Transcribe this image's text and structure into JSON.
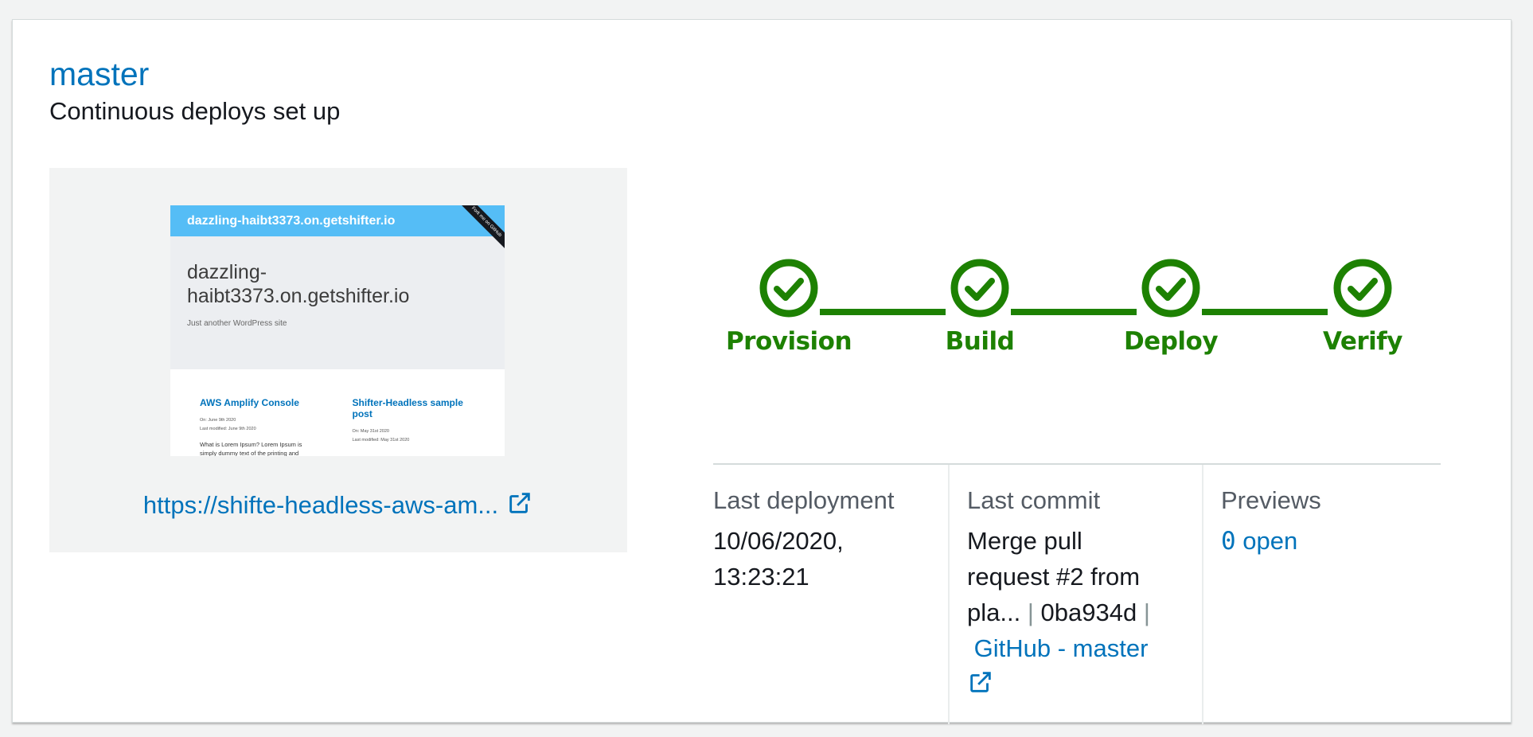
{
  "branch": {
    "name": "master",
    "status": "Continuous deploys set up"
  },
  "preview": {
    "site_bar_title": "dazzling-haibt3373.on.getshifter.io",
    "ribbon": "Fork me on GitHub",
    "hero_title": "dazzling-haibt3373.on.getshifter.io",
    "hero_tagline": "Just another WordPress site",
    "posts": [
      {
        "title": "AWS Amplify Console",
        "date": "On: June 9th 2020",
        "modified": "Last modified: June 9th 2020",
        "excerpt": "What is Lorem Ipsum? Lorem Ipsum is simply dummy text of the printing and typesetting"
      },
      {
        "title": "Shifter-Headless sample post",
        "date": "On: May 31st 2020",
        "modified": "Last modified: May 31st 2020",
        "excerpt": ""
      }
    ],
    "url": "https://shifte-headless-aws-am..."
  },
  "pipeline": {
    "color": "#1d8102",
    "steps": [
      {
        "label": "Provision",
        "status": "complete"
      },
      {
        "label": "Build",
        "status": "complete"
      },
      {
        "label": "Deploy",
        "status": "complete"
      },
      {
        "label": "Verify",
        "status": "complete"
      }
    ]
  },
  "summary": {
    "last_deployment_label": "Last deployment",
    "last_deployment_date": "10/06/2020,",
    "last_deployment_time": "13:23:21",
    "last_commit_label": "Last commit",
    "commit_msg_line1": "Merge pull",
    "commit_msg_line2": "request #2 from",
    "commit_msg_line3": "pla...",
    "commit_sep": "|",
    "commit_hash": "0ba934d",
    "commit_repo_link": "GitHub - master",
    "previews_label": "Previews",
    "previews_count": "0",
    "previews_open": "open"
  },
  "icons": {
    "external_link": "external-link-icon",
    "step_check": "check-circle-icon"
  },
  "colors": {
    "link": "#0073bb",
    "success": "#1d8102",
    "thumb_bar": "#55bdf6"
  }
}
